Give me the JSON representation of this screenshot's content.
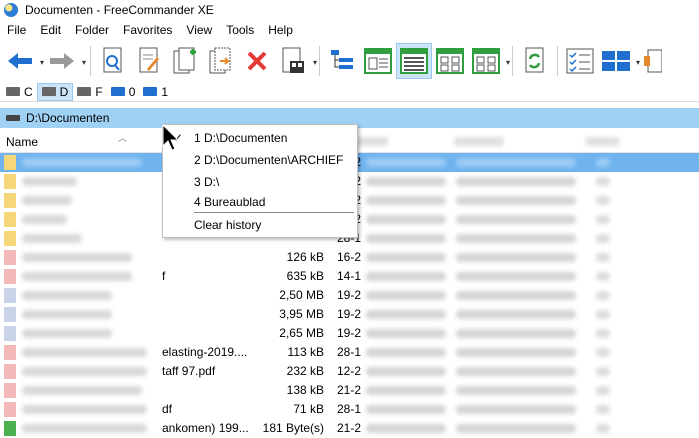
{
  "window": {
    "title": "Documenten - FreeCommander XE"
  },
  "menu": [
    "File",
    "Edit",
    "Folder",
    "Favorites",
    "View",
    "Tools",
    "Help"
  ],
  "toolbar": {
    "icons": [
      "back-arrow-icon",
      "forward-arrow-icon",
      "search-icon",
      "edit-file-icon",
      "new-file-icon",
      "move-file-icon",
      "delete-icon",
      "properties-icon",
      "tree-view-icon",
      "details-view-icon",
      "list-view-icon",
      "thumbnails-view-icon",
      "large-thumbnails-view-icon",
      "sync-icon",
      "checklist-icon",
      "layout-icon",
      "extra-icon"
    ]
  },
  "drives": [
    {
      "label": "C",
      "icon": "drive-icon"
    },
    {
      "label": "D",
      "icon": "drive-icon",
      "active": true
    },
    {
      "label": "F",
      "icon": "drive-icon"
    },
    {
      "label": "0",
      "icon": "monitor-icon"
    },
    {
      "label": "1",
      "icon": "network-drive-icon"
    }
  ],
  "pathbar": {
    "path": "D:\\Documenten"
  },
  "columns": {
    "name": "Name"
  },
  "rows": [
    {
      "name_tail": "",
      "size": "",
      "date": "19-2",
      "icon_color": "#f5d77a",
      "selected": true,
      "blur_w": 120
    },
    {
      "name_tail": "",
      "size": "",
      "date": "19-2",
      "icon_color": "#f5d77a",
      "blur_w": 55
    },
    {
      "name_tail": "",
      "size": "",
      "date": "19-2",
      "icon_color": "#f5d77a",
      "blur_w": 50
    },
    {
      "name_tail": "",
      "size": "",
      "date": "19-2",
      "icon_color": "#f5d77a",
      "blur_w": 45
    },
    {
      "name_tail": "",
      "size": "",
      "date": "28-1",
      "icon_color": "#f5d77a",
      "blur_w": 60
    },
    {
      "name_tail": "",
      "size": "126 kB",
      "date": "16-2",
      "icon_color": "#f2b7b7",
      "blur_w": 110
    },
    {
      "name_tail": "f",
      "size": "635 kB",
      "date": "14-1",
      "icon_color": "#f2b7b7",
      "blur_w": 110
    },
    {
      "name_tail": "",
      "size": "2,50 MB",
      "date": "19-2",
      "icon_color": "#c9d4ea",
      "blur_w": 90
    },
    {
      "name_tail": "",
      "size": "3,95 MB",
      "date": "19-2",
      "icon_color": "#c9d4ea",
      "blur_w": 90
    },
    {
      "name_tail": "",
      "size": "2,65 MB",
      "date": "19-2",
      "icon_color": "#c9d4ea",
      "blur_w": 90
    },
    {
      "name_tail": "elasting-2019....",
      "size": "113 kB",
      "date": "28-1",
      "icon_color": "#f2b7b7",
      "blur_w": 125
    },
    {
      "name_tail": "taff 97.pdf",
      "size": "232 kB",
      "date": "12-2",
      "icon_color": "#f2b7b7",
      "blur_w": 125
    },
    {
      "name_tail": "",
      "size": "138 kB",
      "date": "21-2",
      "icon_color": "#f2b7b7",
      "blur_w": 120
    },
    {
      "name_tail": "df",
      "size": "71 kB",
      "date": "28-1",
      "icon_color": "#f2b7b7",
      "blur_w": 125
    },
    {
      "name_tail": "ankomen) 199...",
      "size": "181 Byte(s)",
      "date": "21-2",
      "icon_color": "#4caf50",
      "blur_w": 125
    }
  ],
  "history_popup": {
    "items": [
      "1 D:\\Documenten",
      "2 D:\\Documenten\\ARCHIEF",
      "3 D:\\",
      "4 Bureaublad"
    ],
    "clear": "Clear history"
  },
  "colors": {
    "accent": "#9fd1f5",
    "selection": "#6fb3ef",
    "toolbar_selected": "#cce4f7"
  }
}
